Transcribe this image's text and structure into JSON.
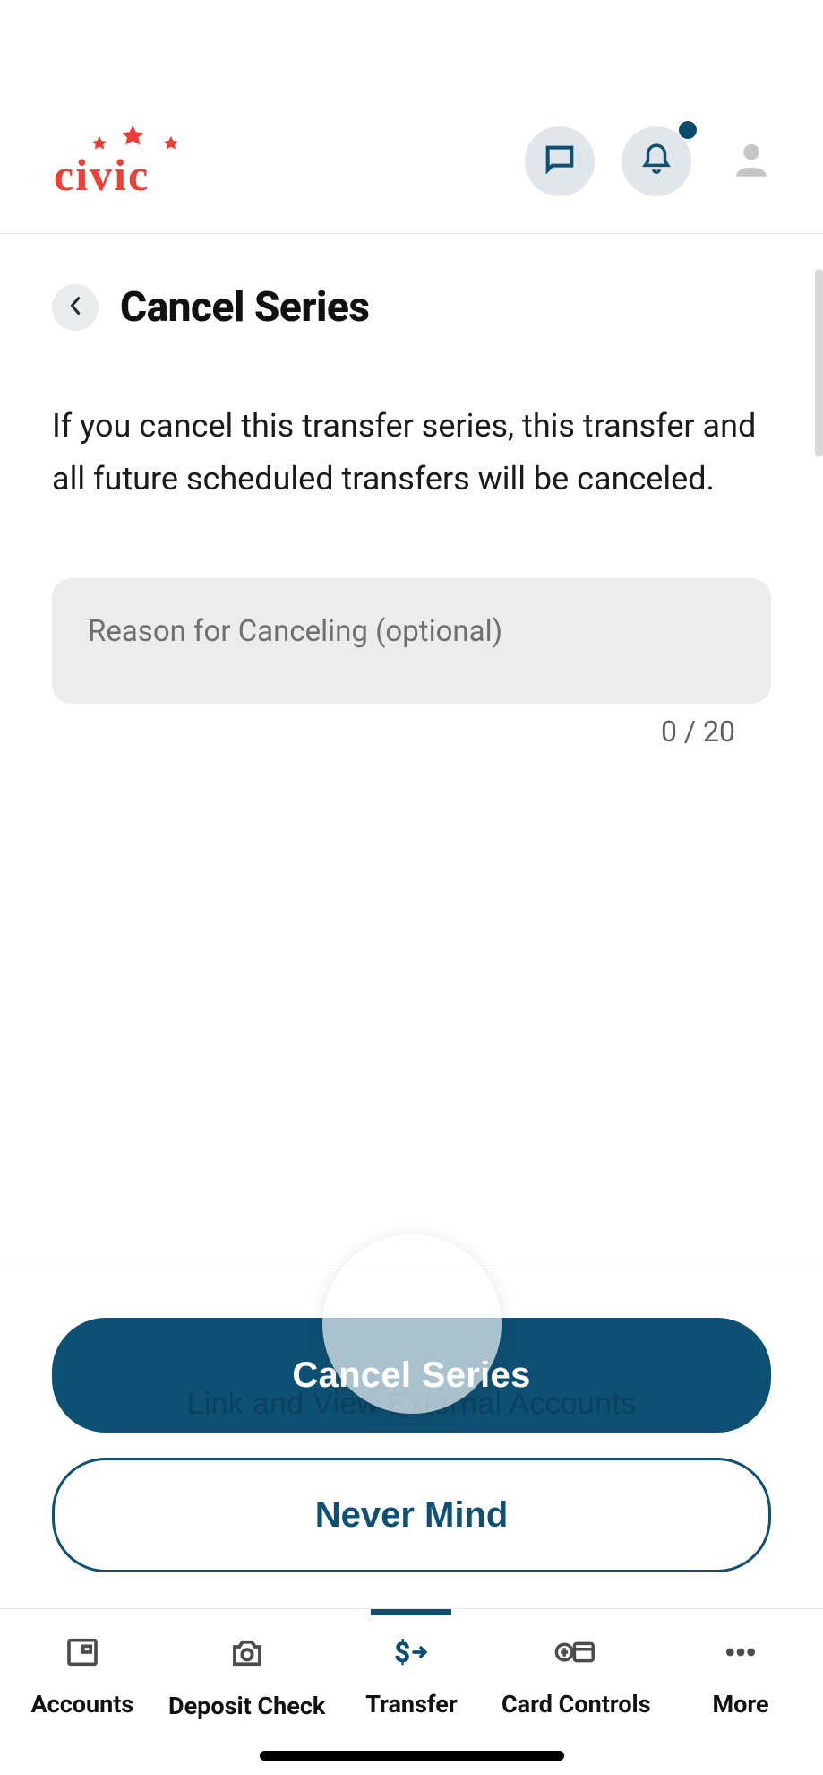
{
  "brand": "civic",
  "page": {
    "title": "Cancel Series",
    "description": "If you cancel this transfer series, this transfer and all future scheduled transfers will be canceled.",
    "reason_placeholder": "Reason for Canceling (optional)",
    "char_count": "0 / 20",
    "ghost_link": "Link and View External Accounts"
  },
  "buttons": {
    "primary": "Cancel Series",
    "secondary": "Never Mind"
  },
  "tabs": {
    "accounts": "Accounts",
    "deposit": "Deposit Check",
    "transfer": "Transfer",
    "card": "Card Controls",
    "more": "More"
  }
}
